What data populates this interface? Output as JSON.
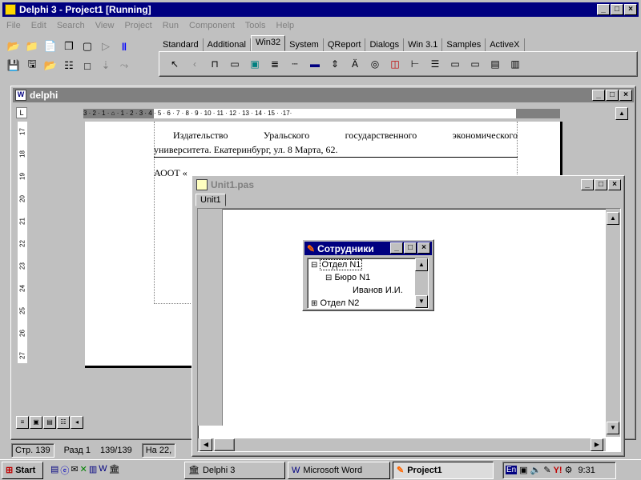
{
  "ide": {
    "title": "Delphi 3 - Project1 [Running]",
    "menu": [
      "File",
      "Edit",
      "Search",
      "View",
      "Project",
      "Run",
      "Component",
      "Tools",
      "Help"
    ],
    "palette_tabs": [
      "Standard",
      "Additional",
      "Win32",
      "System",
      "QReport",
      "Dialogs",
      "Win 3.1",
      "Samples",
      "ActiveX"
    ],
    "palette_selected": "Win32"
  },
  "word": {
    "title": "delphi",
    "ruler_text": "3 · 2 · 1 · ⌂ · 1 · 2 · 3 · 4 · 5 · 6 · 7 · 8 · 9 · 10 · 11 · 12 · 13 · 14 · 15 ·  ·17·",
    "vruler": [
      "17",
      "18",
      "19",
      "20",
      "21",
      "22",
      "23",
      "24",
      "25",
      "26",
      "27"
    ],
    "text_line1": "Издательство Уральского государственного экономического",
    "text_line2": "университета. Екатеринбург, ул. 8 Марта, 62.",
    "text_line3": "АООТ «",
    "status": {
      "page": "Стр. 139",
      "section": "Разд 1",
      "pages": "139/139",
      "at": "На 22,"
    }
  },
  "unit": {
    "title": "Unit1.pas",
    "tab": "Unit1"
  },
  "form": {
    "title": "Сотрудники",
    "tree": [
      {
        "label": "Отдел N1",
        "sign": "⊟",
        "level": 0,
        "selected": true
      },
      {
        "label": "Бюро N1",
        "sign": "⊟",
        "level": 1,
        "selected": false
      },
      {
        "label": "Иванов И.И.",
        "sign": "",
        "level": 2,
        "selected": false
      },
      {
        "label": "Отдел N2",
        "sign": "⊞",
        "level": 0,
        "selected": false
      }
    ]
  },
  "taskbar": {
    "start": "Start",
    "tasks": [
      "Delphi 3",
      "Microsoft Word",
      "Project1"
    ],
    "active_task": "Project1",
    "lang": "En",
    "clock": "9:31"
  }
}
